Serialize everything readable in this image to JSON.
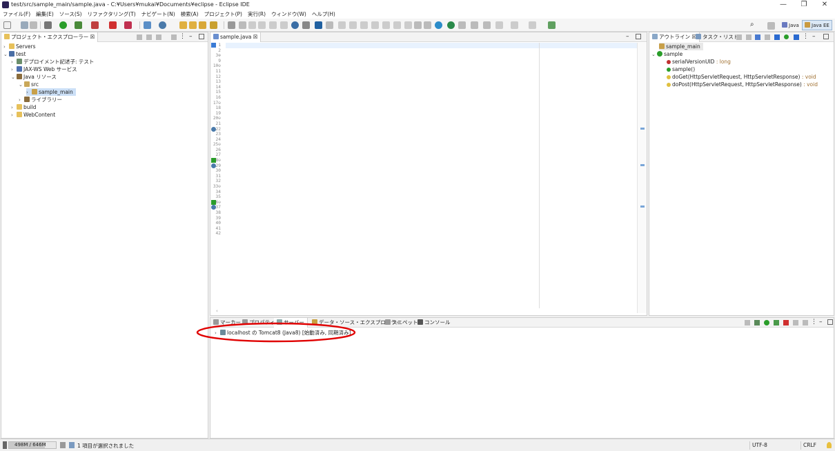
{
  "window": {
    "title": "test/src/sample_main/sample.java - C:¥Users¥mukai¥Documents¥eclipse - Eclipse IDE"
  },
  "menu": [
    "ファイル(F)",
    "編集(E)",
    "ソース(S)",
    "リファクタリング(T)",
    "ナビゲート(N)",
    "検索(A)",
    "プロジェクト(P)",
    "実行(R)",
    "ウィンドウ(W)",
    "ヘルプ(H)"
  ],
  "perspectives": {
    "java": "Java",
    "javaee": "Java EE"
  },
  "explorer": {
    "tab": "プロジェクト・エクスプローラー ☒",
    "items": [
      {
        "label": "Servers"
      },
      {
        "label": "test"
      },
      {
        "label": "デプロイメント記述子: テスト"
      },
      {
        "label": "JAX-WS Web サービス"
      },
      {
        "label": "Java リソース"
      },
      {
        "label": "src"
      },
      {
        "label": "sample_main"
      },
      {
        "label": "ライブラリー"
      },
      {
        "label": "build"
      },
      {
        "label": "WebContent"
      }
    ]
  },
  "editor": {
    "tab": "sample.java ☒",
    "line_numbers": [
      "1",
      "2",
      "3⊕",
      "9",
      "10⊖",
      "11",
      "12",
      "13",
      "14",
      "15",
      "16",
      "17⊖",
      "18",
      "19",
      "20⊖",
      "21",
      "22",
      "23",
      "24",
      "25⊖",
      "26",
      "27",
      "28⊖",
      "29",
      "30",
      "31",
      "32",
      "33⊖",
      "34",
      "35",
      "36⊖",
      "37",
      "38",
      "39",
      "40",
      "41",
      "42"
    ]
  },
  "outline": {
    "tabs": [
      "アウトライン ☒",
      "タスク・リスト"
    ],
    "items": [
      {
        "label": "sample_main"
      },
      {
        "label": "sample"
      },
      {
        "label": "serialVersionUID",
        "type": " : long"
      },
      {
        "label": "sample()"
      },
      {
        "label": "doGet(HttpServletRequest, HttpServletResponse)",
        "type": " : void"
      },
      {
        "label": "doPost(HttpServletRequest, HttpServletResponse)",
        "type": " : void"
      }
    ]
  },
  "bottom": {
    "tabs": [
      "マーカー",
      "プロパティー",
      "サーバー",
      "データ・ソース・エクスプローラー",
      "スニペット",
      "コンソール"
    ],
    "server_row": "localhost の Tomcat8 (Java8)",
    "server_status": "[始動済み, 同期済み]"
  },
  "status": {
    "heap": "498M / 646M",
    "selection": "1 項目が選択されました",
    "encoding": "UTF-8",
    "line_end": "CRLF"
  }
}
